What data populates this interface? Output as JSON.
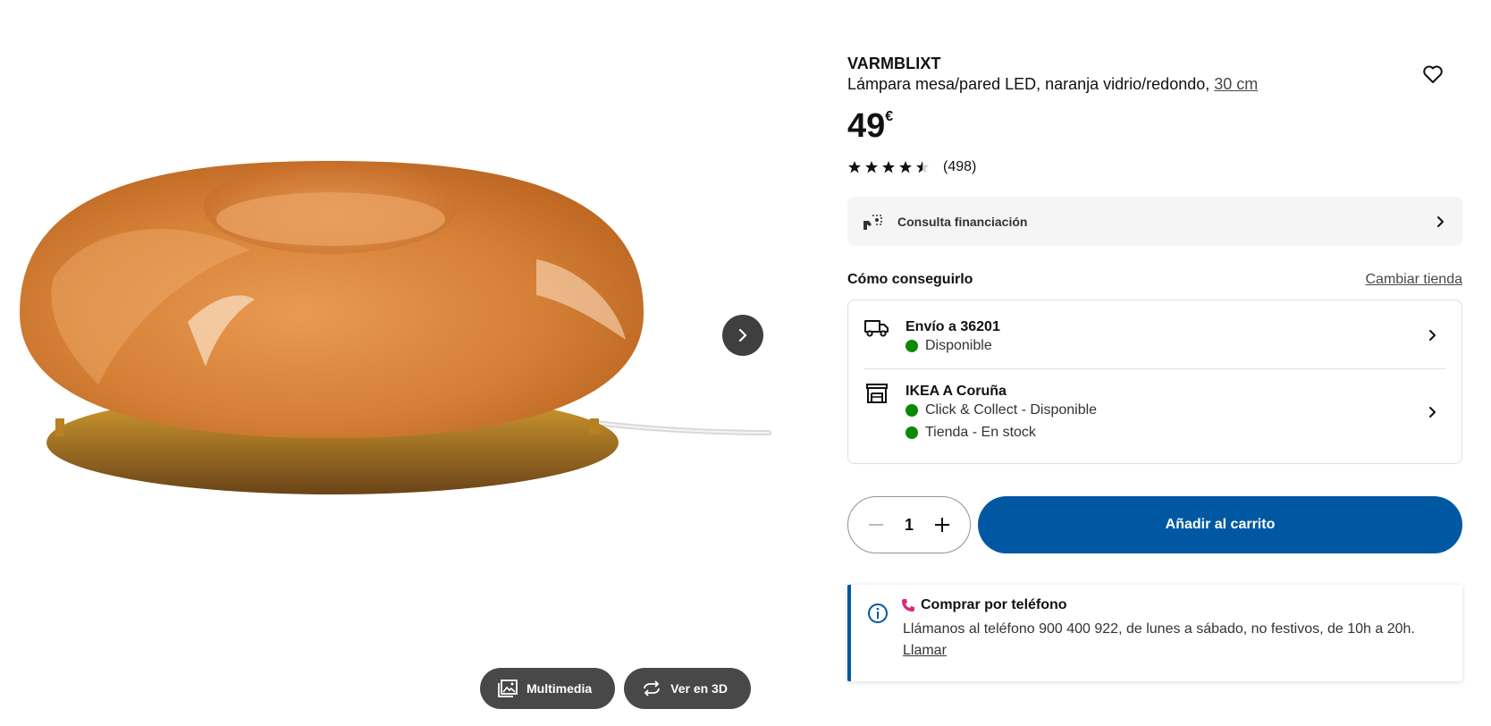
{
  "gallery": {
    "multimedia_label": "Multimedia",
    "view3d_label": "Ver en 3D",
    "image_icon": "lamp-product-image"
  },
  "product": {
    "name": "VARMBLIXT",
    "description": "Lámpara mesa/pared LED, naranja vidrio/redondo, ",
    "size_link": "30 cm",
    "price_value": "49",
    "price_currency": "€",
    "rating_value": 4.5,
    "rating_max": 5,
    "review_count": "(498)"
  },
  "finance": {
    "label": "Consulta financiación"
  },
  "availability": {
    "heading": "Cómo conseguirlo",
    "change_store": "Cambiar tienda",
    "delivery": {
      "title": "Envío a 36201",
      "status": "Disponible"
    },
    "store": {
      "title": "IKEA A Coruña",
      "status_1": "Click & Collect - Disponible",
      "status_2": "Tienda - En stock"
    }
  },
  "cart": {
    "quantity": "1",
    "add_label": "Añadir al carrito"
  },
  "phone": {
    "title": "Comprar por teléfono",
    "text": "Llámanos al teléfono 900 400 922, de lunes a sábado, no festivos, de 10h a 20h.",
    "link": "Llamar"
  },
  "colors": {
    "primary_blue": "#0058a3",
    "available_green": "#0a8a00",
    "lamp_orange": "#d9823a"
  }
}
